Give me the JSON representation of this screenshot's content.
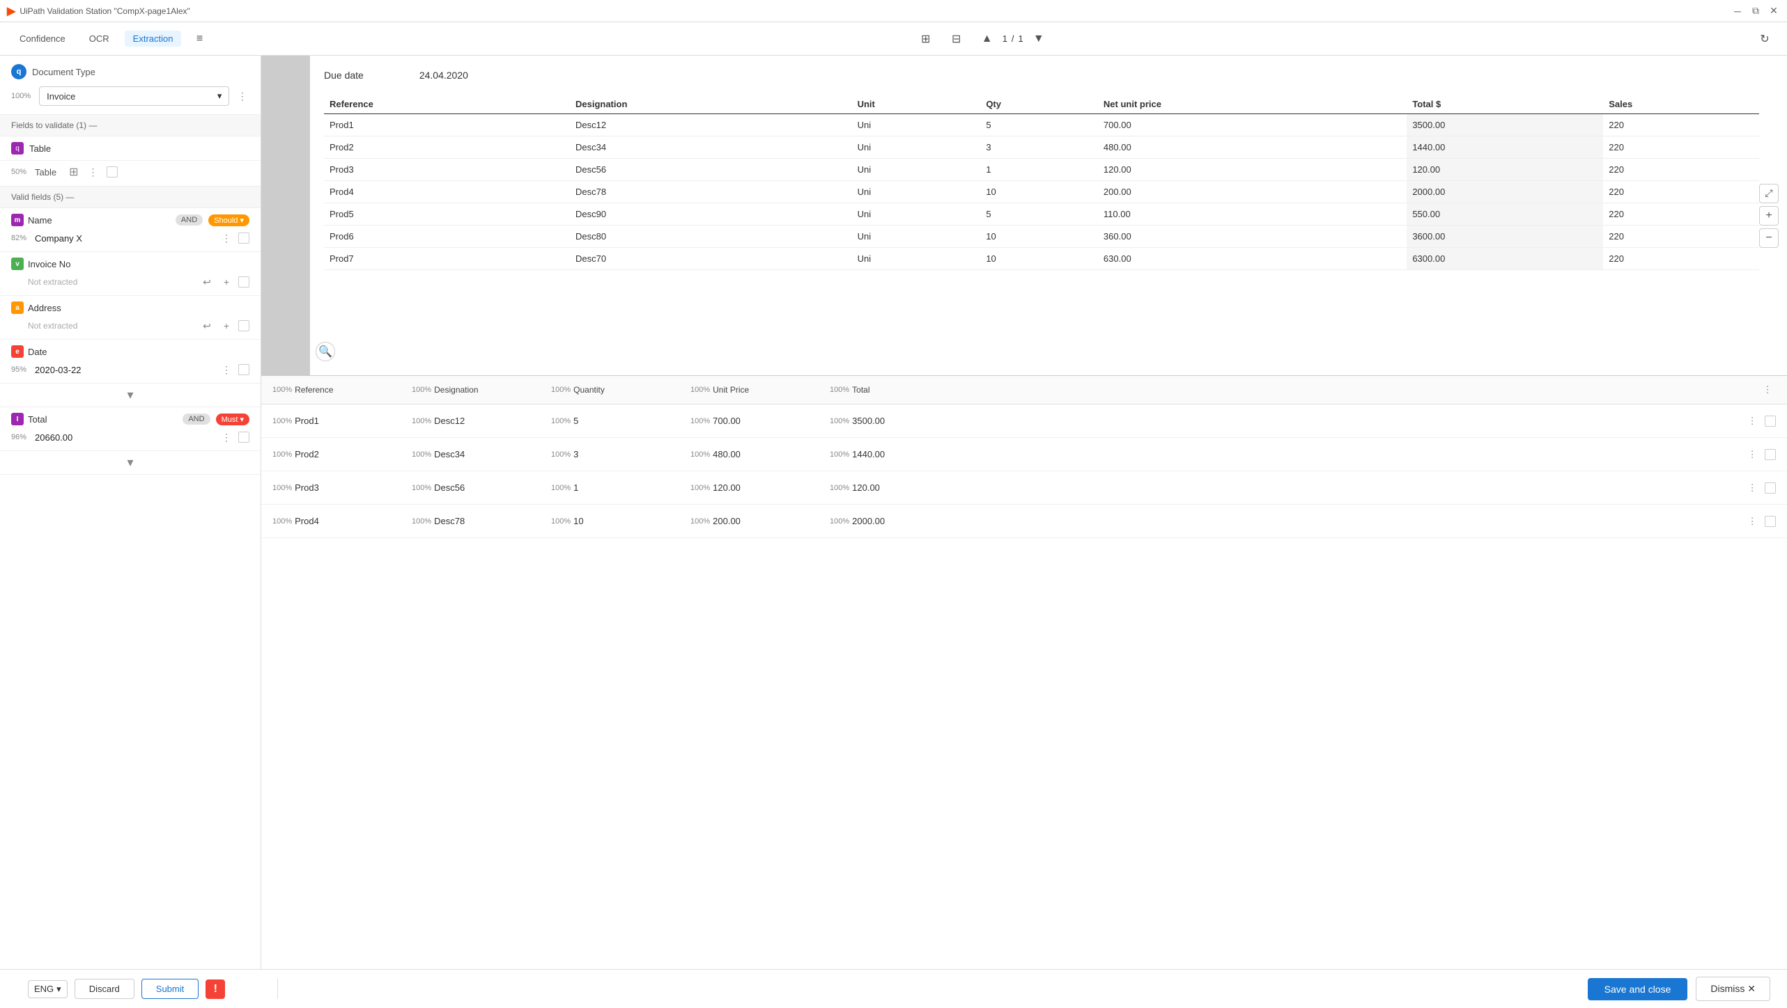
{
  "titlebar": {
    "title": "UiPath Validation Station \"CompX-page1Alex\"",
    "controls": [
      "minimize",
      "restore",
      "close"
    ]
  },
  "toolbar": {
    "tabs": [
      {
        "id": "confidence",
        "label": "Confidence",
        "active": false
      },
      {
        "id": "ocr",
        "label": "OCR",
        "active": false
      },
      {
        "id": "extraction",
        "label": "Extraction",
        "active": true
      }
    ],
    "filter_icon": "≡",
    "layout_icon": "⊞",
    "view_icon": "⊟",
    "page_current": "1",
    "page_total": "1",
    "refresh_icon": "↻"
  },
  "sidebar": {
    "document_type": {
      "icon": "q",
      "label": "Document Type",
      "confidence": "100%",
      "value": "Invoice"
    },
    "valid_fields_header": "Valid fields (5) —",
    "table_field": {
      "icon": "q",
      "label": "Table",
      "confidence": "50%",
      "type": "Table"
    },
    "fields_header": "Fields to validate (1) —",
    "fields": [
      {
        "id": "name",
        "icon": "m",
        "icon_color": "#9c27b0",
        "label": "Name",
        "tag_and": "AND",
        "tag_condition": "Should",
        "tag_color": "#ff9800",
        "confidence": "82%",
        "value": "Company X",
        "has_value": true
      },
      {
        "id": "invoice_no",
        "icon": "v",
        "icon_color": "#4caf50",
        "label": "Invoice No",
        "tag_and": null,
        "tag_condition": null,
        "confidence": null,
        "value": "Not extracted",
        "has_value": false
      },
      {
        "id": "address",
        "icon": "a",
        "icon_color": "#ff9800",
        "label": "Address",
        "tag_and": null,
        "tag_condition": null,
        "confidence": null,
        "value": "Not extracted",
        "has_value": false
      },
      {
        "id": "date",
        "icon": "e",
        "icon_color": "#f44336",
        "label": "Date",
        "tag_and": null,
        "tag_condition": null,
        "confidence": "95%",
        "value": "2020-03-22",
        "has_value": true
      },
      {
        "id": "total",
        "icon": "I",
        "icon_color": "#9c27b0",
        "label": "Total",
        "tag_and": "AND",
        "tag_condition": "Must",
        "tag_color": "#f44336",
        "confidence": "96%",
        "value": "20660.00",
        "has_value": true
      }
    ]
  },
  "document": {
    "due_date_label": "Due date",
    "due_date_value": "24.04.2020",
    "table_headers": [
      "Reference",
      "Designation",
      "Unit",
      "Qty",
      "Net unit price",
      "Total $",
      "Sales"
    ],
    "rows": [
      {
        "ref": "Prod1",
        "desc": "Desc12",
        "unit": "Uni",
        "qty": "5",
        "net": "700.00",
        "total": "3500.00",
        "sales": "220"
      },
      {
        "ref": "Prod2",
        "desc": "Desc34",
        "unit": "Uni",
        "qty": "3",
        "net": "480.00",
        "total": "1440.00",
        "sales": "220"
      },
      {
        "ref": "Prod3",
        "desc": "Desc56",
        "unit": "Uni",
        "qty": "1",
        "net": "120.00",
        "total": "120.00",
        "sales": "220"
      },
      {
        "ref": "Prod4",
        "desc": "Desc78",
        "unit": "Uni",
        "qty": "10",
        "net": "200.00",
        "total": "2000.00",
        "sales": "220"
      },
      {
        "ref": "Prod5",
        "desc": "Desc90",
        "unit": "Uni",
        "qty": "5",
        "net": "110.00",
        "total": "550.00",
        "sales": "220"
      },
      {
        "ref": "Prod6",
        "desc": "Desc80",
        "unit": "Uni",
        "qty": "10",
        "net": "360.00",
        "total": "3600.00",
        "sales": "220"
      },
      {
        "ref": "Prod7",
        "desc": "Desc70",
        "unit": "Uni",
        "qty": "10",
        "net": "630.00",
        "total": "6300.00",
        "sales": "220"
      }
    ]
  },
  "data_table": {
    "columns": [
      {
        "conf": "100%",
        "name": "Reference"
      },
      {
        "conf": "100%",
        "name": "Designation"
      },
      {
        "conf": "100%",
        "name": "Quantity"
      },
      {
        "conf": "100%",
        "name": "Unit Price"
      },
      {
        "conf": "100%",
        "name": "Total"
      }
    ],
    "rows": [
      {
        "conf": "100%",
        "ref_conf": "100%",
        "ref": "Prod1",
        "desc_conf": "100%",
        "desc": "Desc12",
        "qty_conf": "100%",
        "qty": "5",
        "unit_conf": "100%",
        "unit": "700.00",
        "total_conf": "100%",
        "total": "3500.00"
      },
      {
        "conf": "100%",
        "ref_conf": "100%",
        "ref": "Prod2",
        "desc_conf": "100%",
        "desc": "Desc34",
        "qty_conf": "100%",
        "qty": "3",
        "unit_conf": "100%",
        "unit": "480.00",
        "total_conf": "100%",
        "total": "1440.00"
      },
      {
        "conf": "100%",
        "ref_conf": "100%",
        "ref": "Prod3",
        "desc_conf": "100%",
        "desc": "Desc56",
        "qty_conf": "100%",
        "qty": "1",
        "unit_conf": "100%",
        "unit": "120.00",
        "total_conf": "100%",
        "total": "120.00"
      },
      {
        "conf": "100%",
        "ref_conf": "100%",
        "ref": "Prod4",
        "desc_conf": "100%",
        "desc": "Desc78",
        "qty_conf": "100%",
        "qty": "10",
        "unit_conf": "100%",
        "unit": "200.00",
        "total_conf": "100%",
        "total": "2000.00"
      }
    ]
  },
  "bottom_bar": {
    "language": "ENG",
    "discard_label": "Discard",
    "submit_label": "Submit",
    "save_close_label": "Save and close",
    "dismiss_label": "Dismiss ✕"
  }
}
